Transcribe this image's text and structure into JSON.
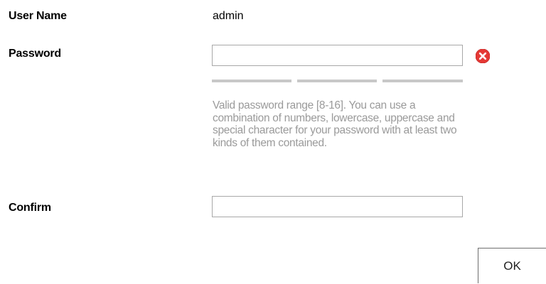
{
  "form": {
    "username": {
      "label": "User Name",
      "value": "admin"
    },
    "password": {
      "label": "Password",
      "value": "",
      "status_icon": "error-x-circle-icon",
      "status_color": "#e53935",
      "strength_segments": 3,
      "strength_color": "#c8c8c8",
      "hint": "Valid password range [8-16]. You can use a combination of numbers, lowercase, uppercase and special character for your password with at least two kinds of them contained."
    },
    "confirm": {
      "label": "Confirm",
      "value": ""
    },
    "ok_label": "OK"
  }
}
